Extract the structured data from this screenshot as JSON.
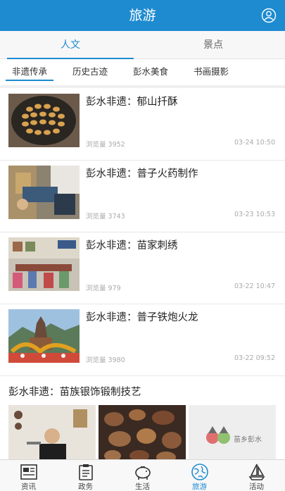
{
  "header": {
    "title": "旅游",
    "user_icon": "user-icon"
  },
  "main_tabs": [
    {
      "label": "人文",
      "active": true
    },
    {
      "label": "景点",
      "active": false
    }
  ],
  "sub_tabs": [
    {
      "label": "非遗传承",
      "active": true
    },
    {
      "label": "历史古迹",
      "active": false
    },
    {
      "label": "彭水美食",
      "active": false
    },
    {
      "label": "书画摄影",
      "active": false
    }
  ],
  "news": [
    {
      "title": "彭水非遗：郁山扦酥",
      "views": "浏览量 3952",
      "date": "03-24 10:50"
    },
    {
      "title": "彭水非遗：普子火药制作",
      "views": "浏览量 3743",
      "date": "03-23 10:53"
    },
    {
      "title": "彭水非遗：苗家刺绣",
      "views": "浏览量 979",
      "date": "03-22 10:47"
    },
    {
      "title": "彭水非遗：普子铁炮火龙",
      "views": "浏览量 3980",
      "date": "03-22 09:52"
    }
  ],
  "big_item": {
    "title": "彭水非遗：苗族银饰锻制技艺",
    "logo_text": "苗乡彭水"
  },
  "bottom_nav": [
    {
      "label": "资讯",
      "icon": "newspaper-icon",
      "active": false
    },
    {
      "label": "政务",
      "icon": "clipboard-icon",
      "active": false
    },
    {
      "label": "生活",
      "icon": "piggy-bank-icon",
      "active": false
    },
    {
      "label": "旅游",
      "icon": "globe-icon",
      "active": true
    },
    {
      "label": "活动",
      "icon": "sailboat-icon",
      "active": false
    }
  ],
  "colors": {
    "accent": "#1e8bd0",
    "header_bg": "#1e8bd0"
  }
}
